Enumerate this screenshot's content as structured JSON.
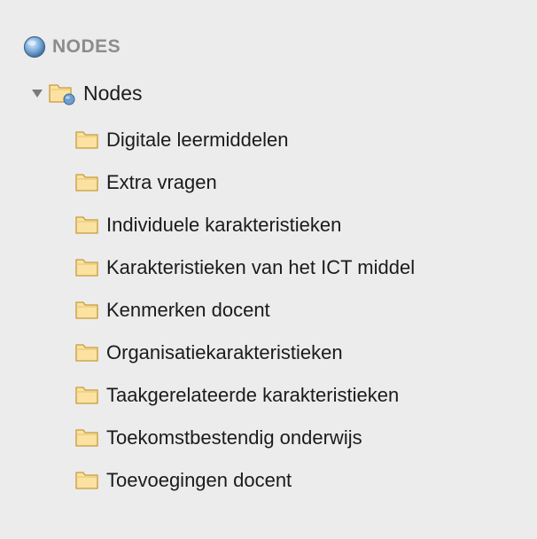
{
  "sidebar": {
    "section": {
      "title": "NODES",
      "icon": "sphere-icon"
    },
    "root": {
      "label": "Nodes",
      "expanded": true,
      "icon": "node-folder-icon"
    },
    "items": [
      {
        "label": "Digitale leermiddelen",
        "icon": "folder-icon"
      },
      {
        "label": "Extra vragen",
        "icon": "folder-icon"
      },
      {
        "label": "Individuele karakteristieken",
        "icon": "folder-icon"
      },
      {
        "label": "Karakteristieken van het ICT middel",
        "icon": "folder-icon"
      },
      {
        "label": "Kenmerken docent",
        "icon": "folder-icon"
      },
      {
        "label": "Organisatiekarakteristieken",
        "icon": "folder-icon"
      },
      {
        "label": "Taakgerelateerde karakteristieken",
        "icon": "folder-icon"
      },
      {
        "label": "Toekomstbestendig onderwijs",
        "icon": "folder-icon"
      },
      {
        "label": "Toevoegingen docent",
        "icon": "folder-icon"
      }
    ]
  },
  "colors": {
    "background": "#ececec",
    "folder_fill": "#fbe2a1",
    "folder_stroke": "#c79a3b",
    "sphere_blue": "#6e9fd0"
  }
}
